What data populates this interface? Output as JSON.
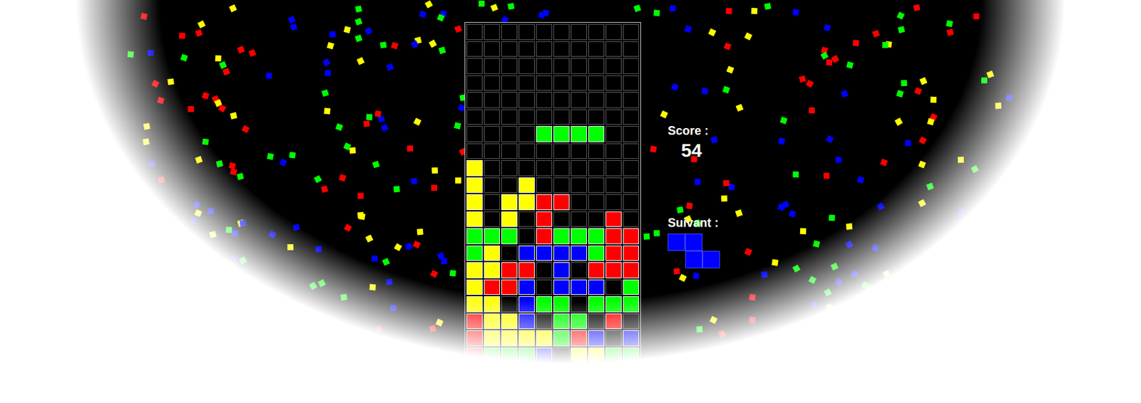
{
  "background": {
    "confetti_colors": [
      "#ff0000",
      "#00ff00",
      "#ffff00",
      "#0000ff"
    ]
  },
  "board": {
    "rows": [
      [
        null,
        null,
        null,
        null,
        null,
        null,
        null,
        null,
        null,
        null
      ],
      [
        null,
        null,
        null,
        null,
        null,
        null,
        null,
        null,
        null,
        null
      ],
      [
        null,
        null,
        null,
        null,
        null,
        null,
        null,
        null,
        null,
        null
      ],
      [
        null,
        null,
        null,
        null,
        null,
        null,
        null,
        null,
        null,
        null
      ],
      [
        null,
        null,
        null,
        null,
        null,
        null,
        null,
        null,
        null,
        null
      ],
      [
        null,
        null,
        null,
        null,
        null,
        null,
        null,
        null,
        null,
        null
      ],
      [
        null,
        null,
        null,
        null,
        null,
        null,
        null,
        null,
        null,
        null
      ],
      [
        null,
        null,
        null,
        null,
        null,
        null,
        null,
        null,
        null,
        null
      ],
      [
        "#ffff00",
        null,
        null,
        null,
        null,
        null,
        null,
        null,
        null,
        null
      ],
      [
        "#ffff00",
        null,
        null,
        "#ffff00",
        null,
        null,
        null,
        null,
        null,
        null
      ],
      [
        "#ffff00",
        null,
        "#ffff00",
        "#ffff00",
        "#ff0000",
        "#ff0000",
        null,
        null,
        null,
        null
      ],
      [
        "#ffff00",
        null,
        "#ffff00",
        null,
        "#ff0000",
        null,
        null,
        null,
        "#ff0000",
        null
      ],
      [
        "#00ff00",
        "#00ff00",
        "#00ff00",
        null,
        "#ff0000",
        "#00ff00",
        "#00ff00",
        "#00ff00",
        "#ff0000",
        "#ff0000"
      ],
      [
        "#00ff00",
        "#ffff00",
        null,
        "#0000ff",
        "#0000ff",
        "#0000ff",
        "#0000ff",
        "#00ff00",
        "#ff0000",
        "#ff0000"
      ],
      [
        "#ffff00",
        "#ffff00",
        "#ff0000",
        "#ff0000",
        null,
        "#0000ff",
        null,
        "#ff0000",
        "#ff0000",
        "#ff0000"
      ],
      [
        "#ffff00",
        "#ff0000",
        "#ff0000",
        "#0000ff",
        null,
        "#0000ff",
        "#0000ff",
        "#0000ff",
        null,
        "#00ff00"
      ],
      [
        "#ffff00",
        "#ffff00",
        null,
        "#0000ff",
        "#00ff00",
        "#00ff00",
        null,
        "#00ff00",
        "#00ff00",
        "#00ff00"
      ],
      [
        "#ff0000",
        "#ffff00",
        "#ffff00",
        "#0000ff",
        null,
        "#00ff00",
        "#00ff00",
        null,
        "#ff0000",
        null
      ],
      [
        "#ff0000",
        "#ffff00",
        "#ffff00",
        "#ffff00",
        "#ffff00",
        "#00ff00",
        "#ff0000",
        "#0000ff",
        null,
        "#0000ff"
      ],
      [
        "#ff0000",
        "#00ff00",
        "#00ff00",
        "#00ff00",
        "#0000ff",
        null,
        "#ffff00",
        "#ffff00",
        "#00ff00",
        "#00ff00"
      ],
      [
        "#ffff00",
        "#00ff00",
        "#00ff00",
        "#0000ff",
        "#0000ff",
        "#ffff00",
        "#ffff00",
        "#ffff00",
        "#00ff00",
        "#00ff00"
      ]
    ],
    "falling": {
      "row": 6,
      "col": 4,
      "cells": [
        [
          1,
          1,
          1,
          1
        ]
      ],
      "color": "#00ff00"
    }
  },
  "score": {
    "label": "Score :",
    "value": "54"
  },
  "next": {
    "label": "Suivant :",
    "cells": [
      [
        1,
        1,
        0
      ],
      [
        0,
        1,
        1
      ]
    ],
    "color": "#0000ff"
  }
}
